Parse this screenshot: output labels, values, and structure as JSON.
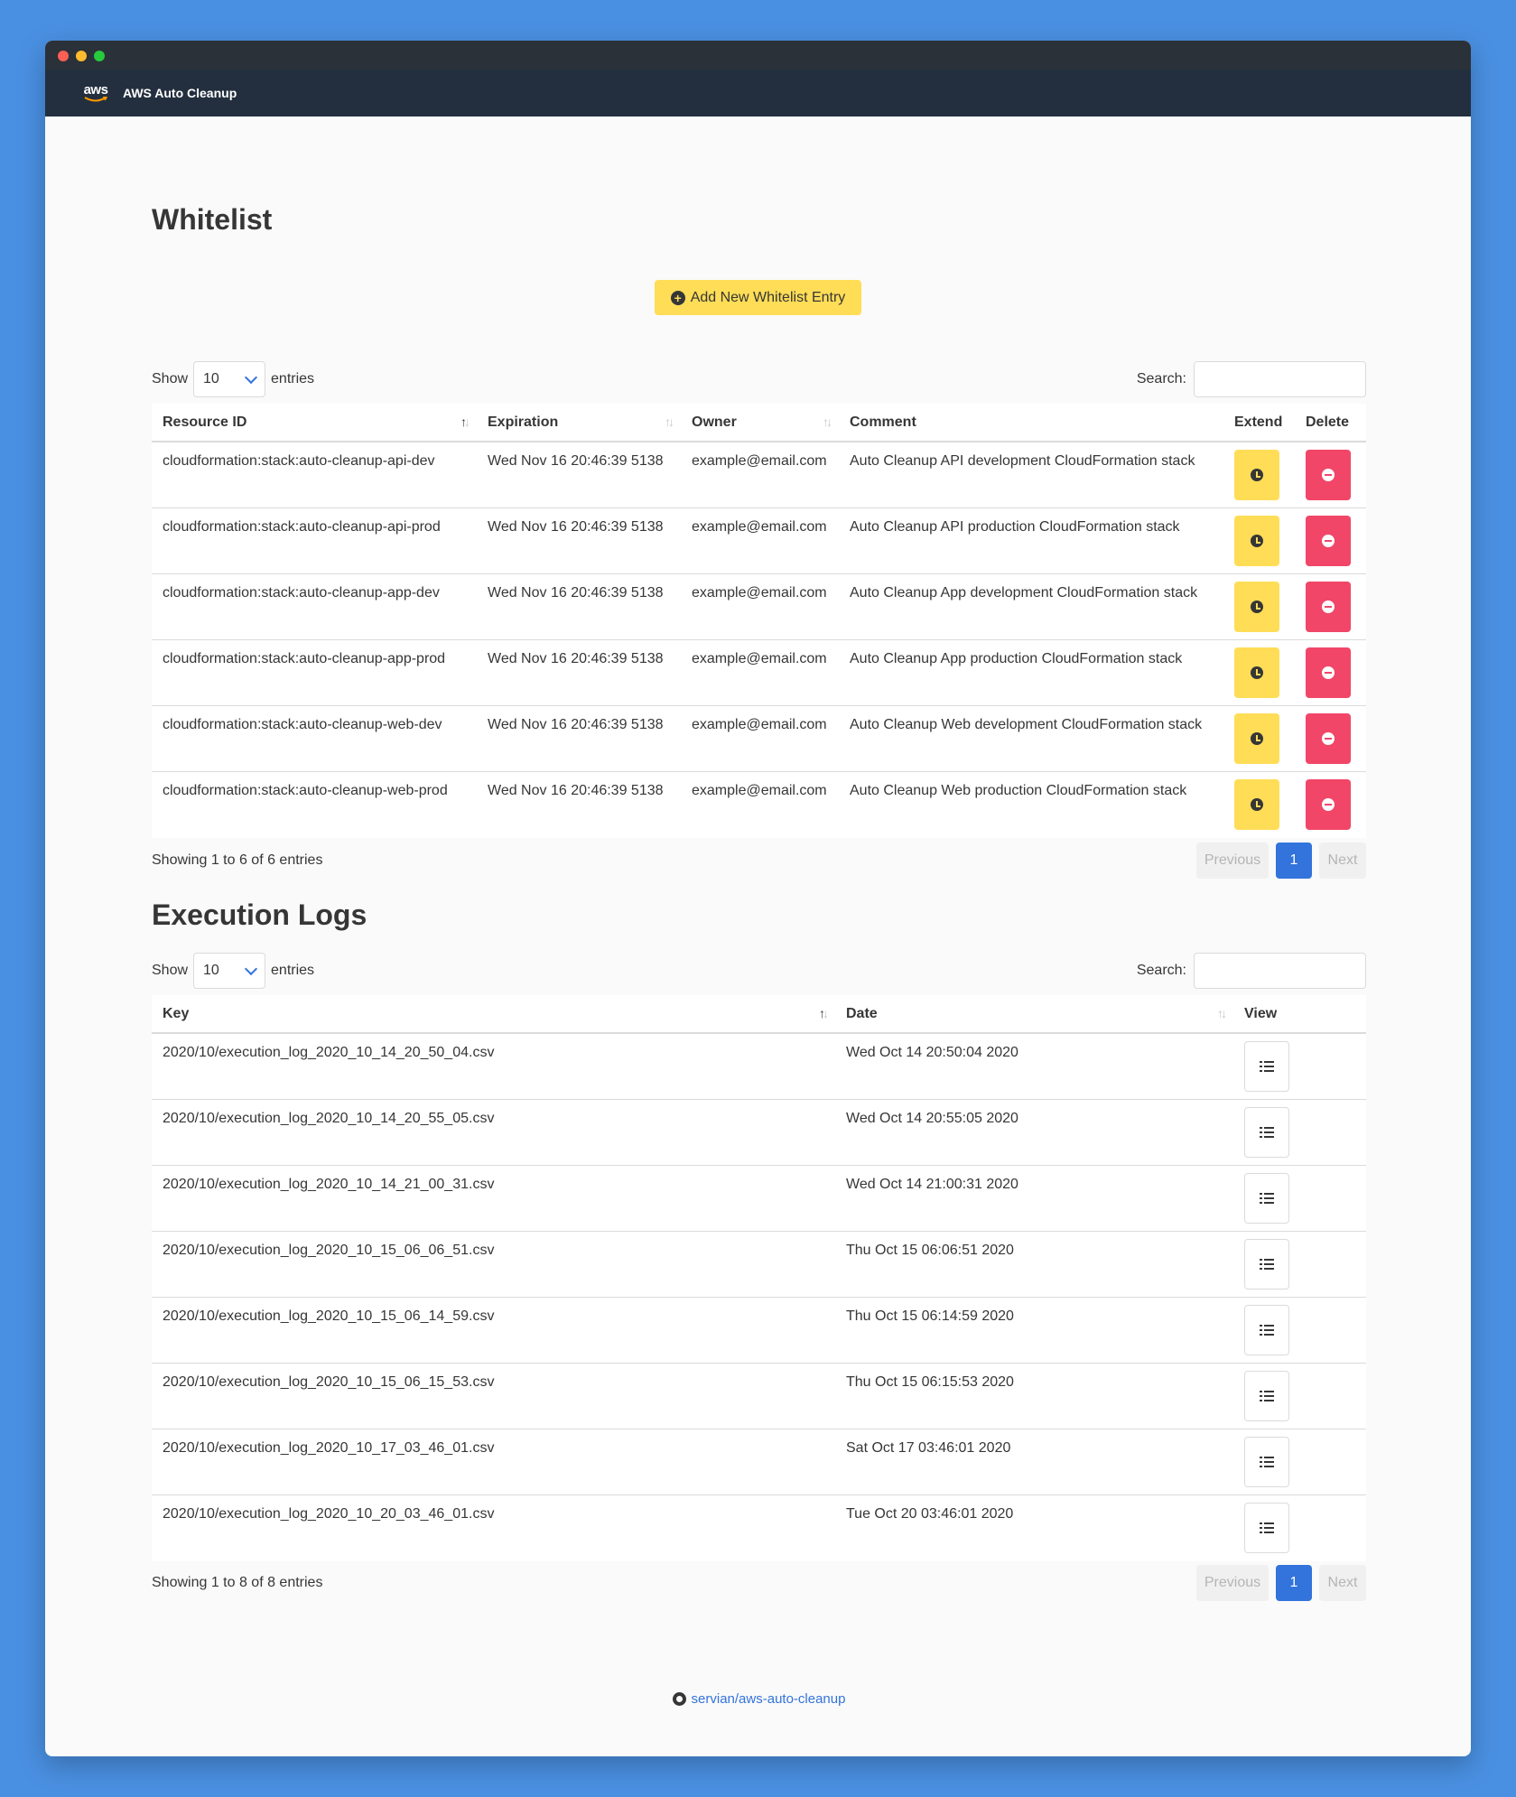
{
  "app": {
    "brand": "AWS Auto Cleanup",
    "logo_text": "aws"
  },
  "whitelist": {
    "title": "Whitelist",
    "add_button_label": "Add New Whitelist Entry",
    "show_label": "Show",
    "entries_label": "entries",
    "page_length": "10",
    "search_label": "Search:",
    "columns": [
      "Resource ID",
      "Expiration",
      "Owner",
      "Comment",
      "Extend",
      "Delete"
    ],
    "rows": [
      {
        "resource_id": "cloudformation:stack:auto-cleanup-api-dev",
        "expiration": "Wed Nov 16 20:46:39 5138",
        "owner": "example@email.com",
        "comment": "Auto Cleanup API development CloudFormation stack"
      },
      {
        "resource_id": "cloudformation:stack:auto-cleanup-api-prod",
        "expiration": "Wed Nov 16 20:46:39 5138",
        "owner": "example@email.com",
        "comment": "Auto Cleanup API production CloudFormation stack"
      },
      {
        "resource_id": "cloudformation:stack:auto-cleanup-app-dev",
        "expiration": "Wed Nov 16 20:46:39 5138",
        "owner": "example@email.com",
        "comment": "Auto Cleanup App development CloudFormation stack"
      },
      {
        "resource_id": "cloudformation:stack:auto-cleanup-app-prod",
        "expiration": "Wed Nov 16 20:46:39 5138",
        "owner": "example@email.com",
        "comment": "Auto Cleanup App production CloudFormation stack"
      },
      {
        "resource_id": "cloudformation:stack:auto-cleanup-web-dev",
        "expiration": "Wed Nov 16 20:46:39 5138",
        "owner": "example@email.com",
        "comment": "Auto Cleanup Web development CloudFormation stack"
      },
      {
        "resource_id": "cloudformation:stack:auto-cleanup-web-prod",
        "expiration": "Wed Nov 16 20:46:39 5138",
        "owner": "example@email.com",
        "comment": "Auto Cleanup Web production CloudFormation stack"
      }
    ],
    "info": "Showing 1 to 6 of 6 entries",
    "pager": {
      "previous": "Previous",
      "current": "1",
      "next": "Next"
    }
  },
  "logs": {
    "title": "Execution Logs",
    "show_label": "Show",
    "entries_label": "entries",
    "page_length": "10",
    "search_label": "Search:",
    "columns": [
      "Key",
      "Date",
      "View"
    ],
    "rows": [
      {
        "key": "2020/10/execution_log_2020_10_14_20_50_04.csv",
        "date": "Wed Oct 14 20:50:04 2020"
      },
      {
        "key": "2020/10/execution_log_2020_10_14_20_55_05.csv",
        "date": "Wed Oct 14 20:55:05 2020"
      },
      {
        "key": "2020/10/execution_log_2020_10_14_21_00_31.csv",
        "date": "Wed Oct 14 21:00:31 2020"
      },
      {
        "key": "2020/10/execution_log_2020_10_15_06_06_51.csv",
        "date": "Thu Oct 15 06:06:51 2020"
      },
      {
        "key": "2020/10/execution_log_2020_10_15_06_14_59.csv",
        "date": "Thu Oct 15 06:14:59 2020"
      },
      {
        "key": "2020/10/execution_log_2020_10_15_06_15_53.csv",
        "date": "Thu Oct 15 06:15:53 2020"
      },
      {
        "key": "2020/10/execution_log_2020_10_17_03_46_01.csv",
        "date": "Sat Oct 17 03:46:01 2020"
      },
      {
        "key": "2020/10/execution_log_2020_10_20_03_46_01.csv",
        "date": "Tue Oct 20 03:46:01 2020"
      }
    ],
    "info": "Showing 1 to 8 of 8 entries",
    "pager": {
      "previous": "Previous",
      "current": "1",
      "next": "Next"
    }
  },
  "footer": {
    "repo_link": "servian/aws-auto-cleanup"
  },
  "colors": {
    "accent_yellow": "#ffdd57",
    "danger_red": "#f14668",
    "link_blue": "#3273dc",
    "navbar": "#232f3e"
  },
  "icons": {
    "extend": "clock-icon",
    "delete": "minus-circle-icon",
    "view": "list-icon",
    "add": "plus-circle-icon",
    "footer": "github-icon"
  }
}
